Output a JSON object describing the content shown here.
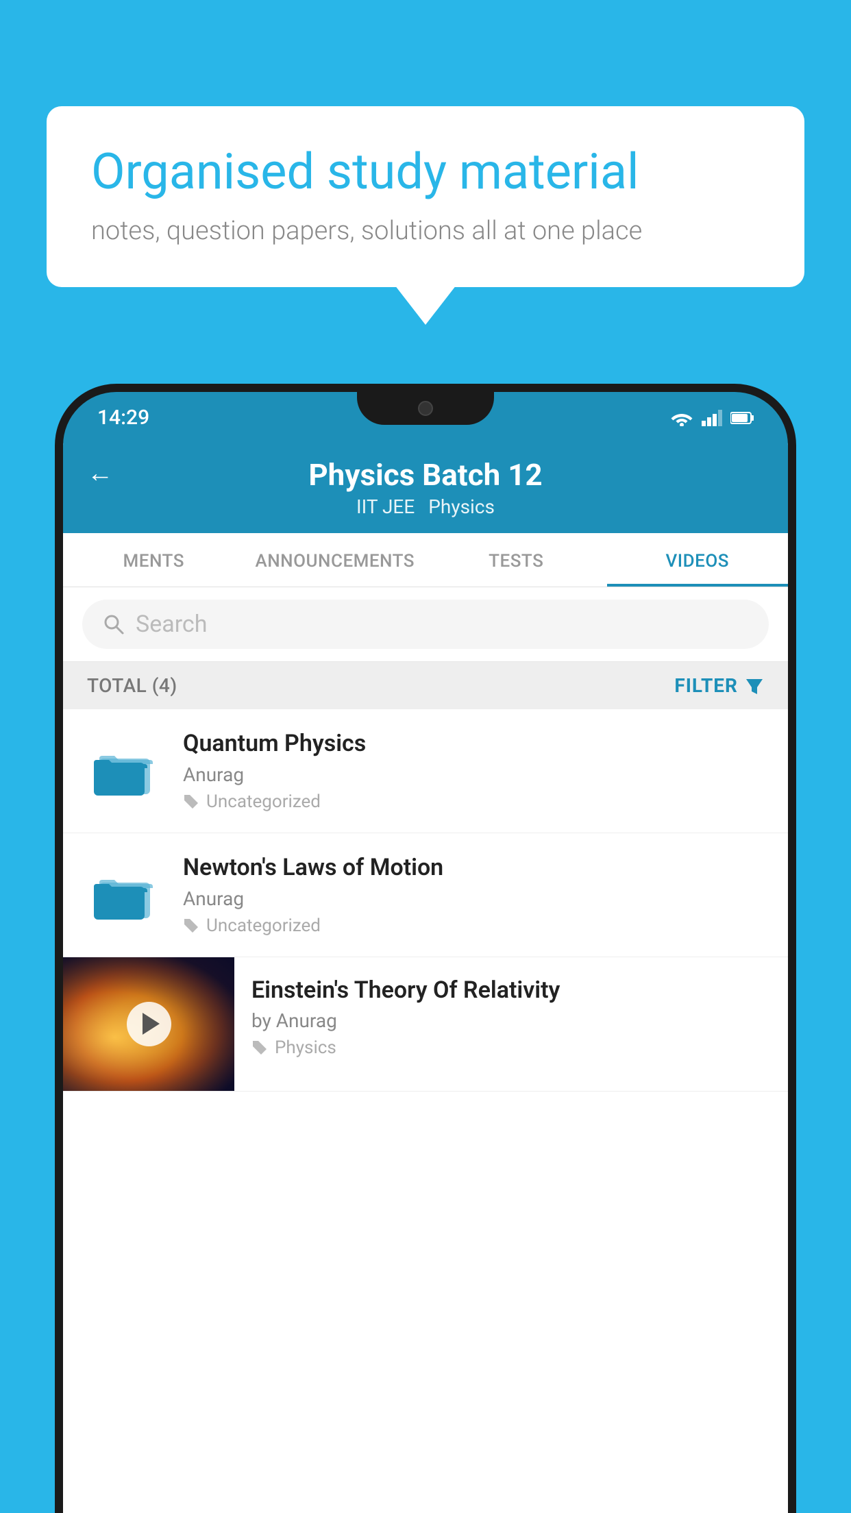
{
  "background_color": "#29b6e8",
  "bubble": {
    "title": "Organised study material",
    "subtitle": "notes, question papers, solutions all at one place"
  },
  "status_bar": {
    "time": "14:29"
  },
  "header": {
    "title": "Physics Batch 12",
    "subtitle_left": "IIT JEE",
    "subtitle_right": "Physics",
    "back_label": "←"
  },
  "tabs": [
    {
      "label": "MENTS",
      "active": false
    },
    {
      "label": "ANNOUNCEMENTS",
      "active": false
    },
    {
      "label": "TESTS",
      "active": false
    },
    {
      "label": "VIDEOS",
      "active": true
    }
  ],
  "search": {
    "placeholder": "Search"
  },
  "filter_bar": {
    "total_label": "TOTAL (4)",
    "filter_label": "FILTER"
  },
  "videos": [
    {
      "id": 1,
      "title": "Quantum Physics",
      "author": "Anurag",
      "tag": "Uncategorized",
      "type": "folder",
      "has_thumbnail": false
    },
    {
      "id": 2,
      "title": "Newton's Laws of Motion",
      "author": "Anurag",
      "tag": "Uncategorized",
      "type": "folder",
      "has_thumbnail": false
    },
    {
      "id": 3,
      "title": "Einstein's Theory Of Relativity",
      "author": "by Anurag",
      "tag": "Physics",
      "type": "video",
      "has_thumbnail": true
    }
  ]
}
